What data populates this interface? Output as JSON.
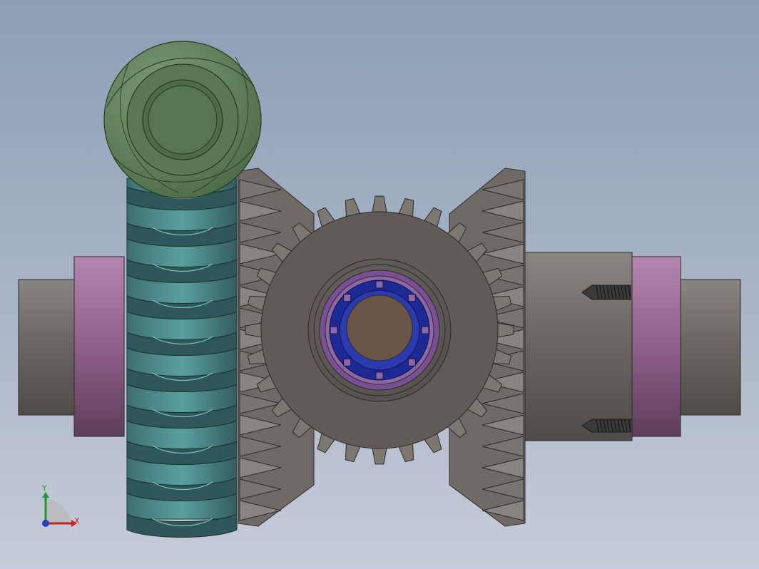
{
  "viewport": {
    "background_top": "#8c9fb5",
    "background_bottom": "#c6ccd9"
  },
  "model": {
    "parts": [
      {
        "name": "worm-wheel",
        "color": "#5f7f58"
      },
      {
        "name": "worm-shaft",
        "color": "#4f8a8a"
      },
      {
        "name": "bevel-gear-left",
        "color": "#7a7470"
      },
      {
        "name": "spur-gear-center",
        "color": "#5e5a57"
      },
      {
        "name": "bearing",
        "color": "#1d2a96"
      },
      {
        "name": "bearing-seal",
        "color": "#7a4f93"
      },
      {
        "name": "shaft",
        "color": "#6c6762"
      },
      {
        "name": "collar-left",
        "color": "#8f5f8a"
      },
      {
        "name": "collar-right",
        "color": "#8f5f8a"
      },
      {
        "name": "set-screw-top",
        "color": "#3a3a3a"
      },
      {
        "name": "set-screw-bottom",
        "color": "#3a3a3a"
      }
    ]
  },
  "triad": {
    "x_label": "X",
    "y_label": "Y",
    "x_color": "#c22626",
    "y_color": "#1e9a2a",
    "z_color": "#2a3ec2"
  }
}
